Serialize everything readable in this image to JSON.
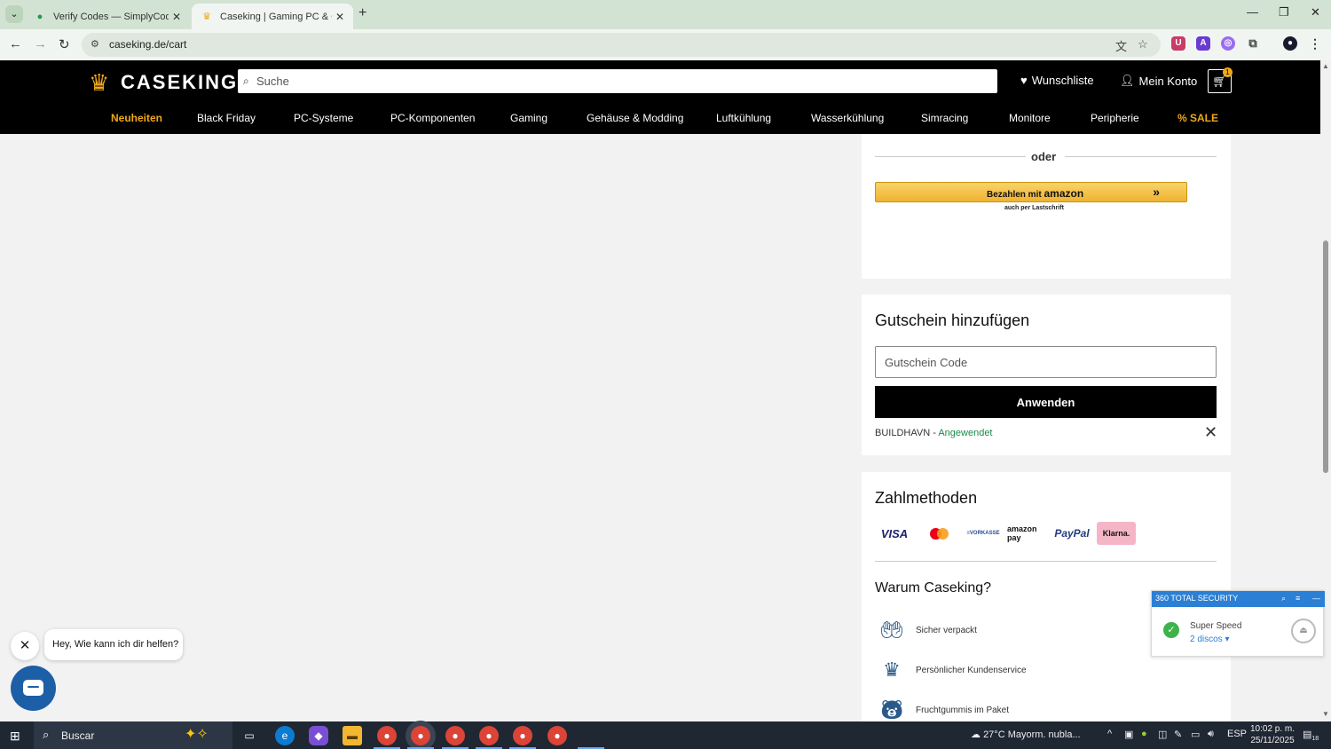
{
  "browser": {
    "tabs": [
      {
        "title": "Verify Codes — SimplyCodes",
        "active": false
      },
      {
        "title": "Caseking | Gaming PC & Comp",
        "active": true
      }
    ],
    "url": "caseking.de/cart"
  },
  "header": {
    "logo": "CASEKING",
    "search_placeholder": "Suche",
    "wishlist": "Wunschliste",
    "account": "Mein Konto",
    "cart_count": "1",
    "nav": [
      "Neuheiten",
      "Black Friday",
      "PC-Systeme",
      "PC-Komponenten",
      "Gaming",
      "Gehäuse & Modding",
      "Luftkühlung",
      "Wasserkühlung",
      "Simracing",
      "Monitore",
      "Peripherie",
      "% SALE"
    ]
  },
  "checkout": {
    "or_label": "oder",
    "amazon_button": "Bezahlen mit",
    "amazon_brand": "amazon",
    "amazon_sub": "auch per Lastschrift"
  },
  "coupon": {
    "title": "Gutschein hinzufügen",
    "placeholder": "Gutschein Code",
    "apply": "Anwenden",
    "applied_code": "BUILDHAVN",
    "applied_sep": " - ",
    "applied_status": "Angewendet"
  },
  "payment": {
    "title": "Zahlmethoden",
    "methods": [
      "VISA",
      "mastercard",
      "VORKASSE",
      "amazon pay",
      "PayPal",
      "Klarna."
    ],
    "why_title": "Warum Caseking?",
    "why_items": [
      "Sicher verpackt",
      "Persönlicher Kundenservice",
      "Fruchtgummis im Paket"
    ]
  },
  "chat": {
    "greeting": "Hey, Wie kann ich dir helfen?"
  },
  "security": {
    "brand": "360 TOTAL SECURITY",
    "title": "Super Speed",
    "link": "2 discos"
  },
  "taskbar": {
    "search": "Buscar",
    "weather": "27°C  Mayorm. nubla...",
    "lang": "ESP",
    "time": "10:02 p. m.",
    "date": "25/11/2025",
    "notifications": "18"
  },
  "colors": {
    "accent": "#f0a81b",
    "success": "#1a8a4a",
    "chat": "#1d5fa6",
    "security": "#2b7fd4"
  }
}
